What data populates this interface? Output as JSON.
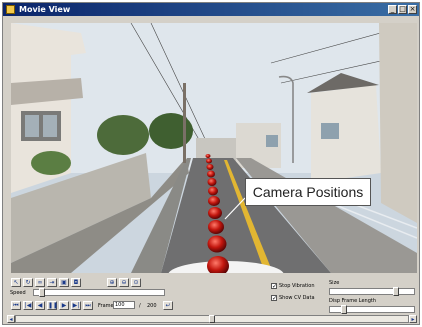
{
  "window": {
    "title": "Movie View"
  },
  "annotation": {
    "text": "Camera Positions"
  },
  "toolbar": {
    "left_buttons": [
      "arrow-tool-icon",
      "refresh-icon",
      "loop-icon",
      "step-icon",
      "lock-icon",
      "camera-icon"
    ],
    "zoom_buttons": [
      "zoom-in-icon",
      "zoom-out-icon",
      "zoom-fit-icon"
    ]
  },
  "speed": {
    "label": "Speed",
    "level": 0.05
  },
  "playback": {
    "buttons": [
      "first-frame-icon",
      "previous-icon",
      "rewind-icon",
      "pause-icon",
      "play-icon",
      "next-icon",
      "last-frame-icon"
    ],
    "frame_label": "Frame",
    "frame_value": "100",
    "frame_separator": "/",
    "frame_total": "200"
  },
  "options": {
    "stop_vibration": {
      "label": "Stop Vibration",
      "checked": true
    },
    "show_cv_data": {
      "label": "Show CV Data",
      "checked": true
    }
  },
  "size": {
    "label": "Size",
    "level": 0.8
  },
  "disp_frame_length": {
    "label": "Disp Frame Length",
    "level": 0.15
  },
  "timeline": {
    "position": 0.5
  }
}
